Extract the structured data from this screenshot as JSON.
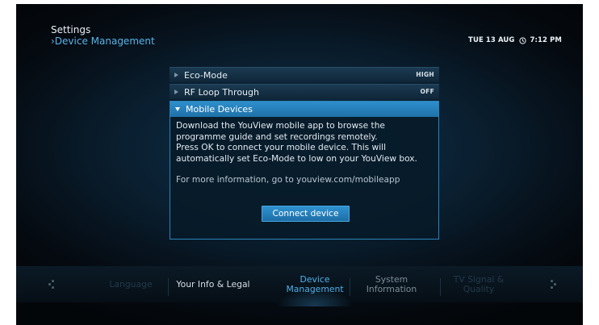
{
  "header": {
    "title": "Settings",
    "breadcrumb": "›Device Management",
    "clock": "TUE 13 AUG",
    "time": "7:12 PM"
  },
  "menu": {
    "items": [
      {
        "label": "Eco-Mode",
        "value": "HIGH"
      },
      {
        "label": "RF Loop Through",
        "value": "OFF"
      }
    ],
    "expanded": {
      "label": "Mobile Devices",
      "line1": "Download the YouView mobile app to browse the",
      "line2": "programme guide and set recordings remotely.",
      "line3": "Press OK to connect your mobile device. This will",
      "line4": "automatically set Eco-Mode to low on your YouView box.",
      "info": "For more information, go to youview.com/mobileapp",
      "button": "Connect device"
    }
  },
  "tabs": [
    {
      "label": "Language"
    },
    {
      "label": "Your Info & Legal"
    },
    {
      "label_line1": "Device",
      "label_line2": "Management"
    },
    {
      "label_line1": "System",
      "label_line2": "Information"
    },
    {
      "label_line1": "TV Signal &",
      "label_line2": "Quality"
    }
  ],
  "colors": {
    "accent": "#2e8fcc",
    "active_tab": "#4fb0ea",
    "background": "#0a1f30"
  },
  "icons": {
    "clock": "clock-icon",
    "left_nav": "nav-left-dots-icon",
    "right_nav": "nav-right-dots-icon",
    "collapsed": "triangle-right-icon",
    "expanded": "triangle-down-icon"
  }
}
